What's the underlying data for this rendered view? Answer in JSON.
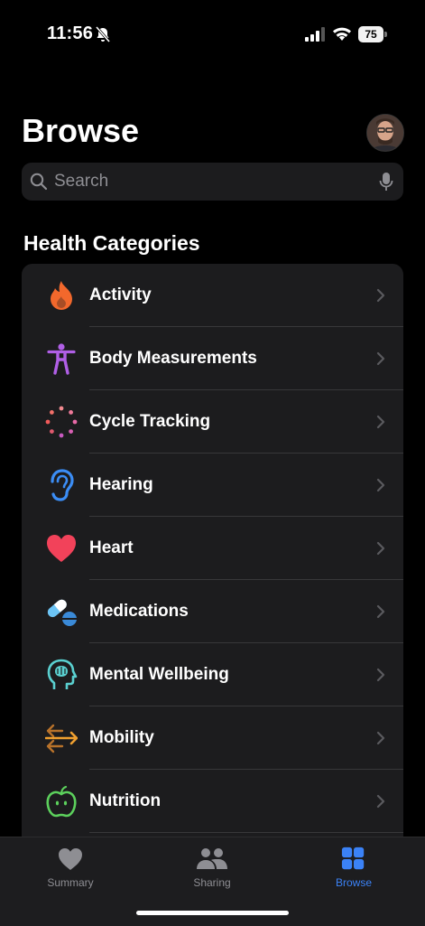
{
  "status_bar": {
    "time": "11:56",
    "battery": "75"
  },
  "page": {
    "title": "Browse"
  },
  "search": {
    "placeholder": "Search"
  },
  "section": {
    "title": "Health Categories"
  },
  "categories": [
    {
      "label": "Activity",
      "icon": "flame-icon",
      "color": "#f2682c"
    },
    {
      "label": "Body Measurements",
      "icon": "figure-icon",
      "color": "#b05fe6"
    },
    {
      "label": "Cycle Tracking",
      "icon": "cycle-icon",
      "color": "#f26a7a"
    },
    {
      "label": "Hearing",
      "icon": "ear-icon",
      "color": "#3b8df5"
    },
    {
      "label": "Heart",
      "icon": "heart-icon",
      "color": "#f2425a"
    },
    {
      "label": "Medications",
      "icon": "pills-icon",
      "color": "#6cc4f5"
    },
    {
      "label": "Mental Wellbeing",
      "icon": "head-brain-icon",
      "color": "#5ad0d0"
    },
    {
      "label": "Mobility",
      "icon": "arrows-icon",
      "color": "#f0a030"
    },
    {
      "label": "Nutrition",
      "icon": "apple-icon",
      "color": "#5cd05c"
    }
  ],
  "tabs": [
    {
      "label": "Summary",
      "icon": "heart-icon",
      "active": false
    },
    {
      "label": "Sharing",
      "icon": "people-icon",
      "active": false
    },
    {
      "label": "Browse",
      "icon": "grid-icon",
      "active": true
    }
  ],
  "colors": {
    "accent": "#3b82f6",
    "inactive": "#8e8e93",
    "card": "#1c1c1e"
  }
}
